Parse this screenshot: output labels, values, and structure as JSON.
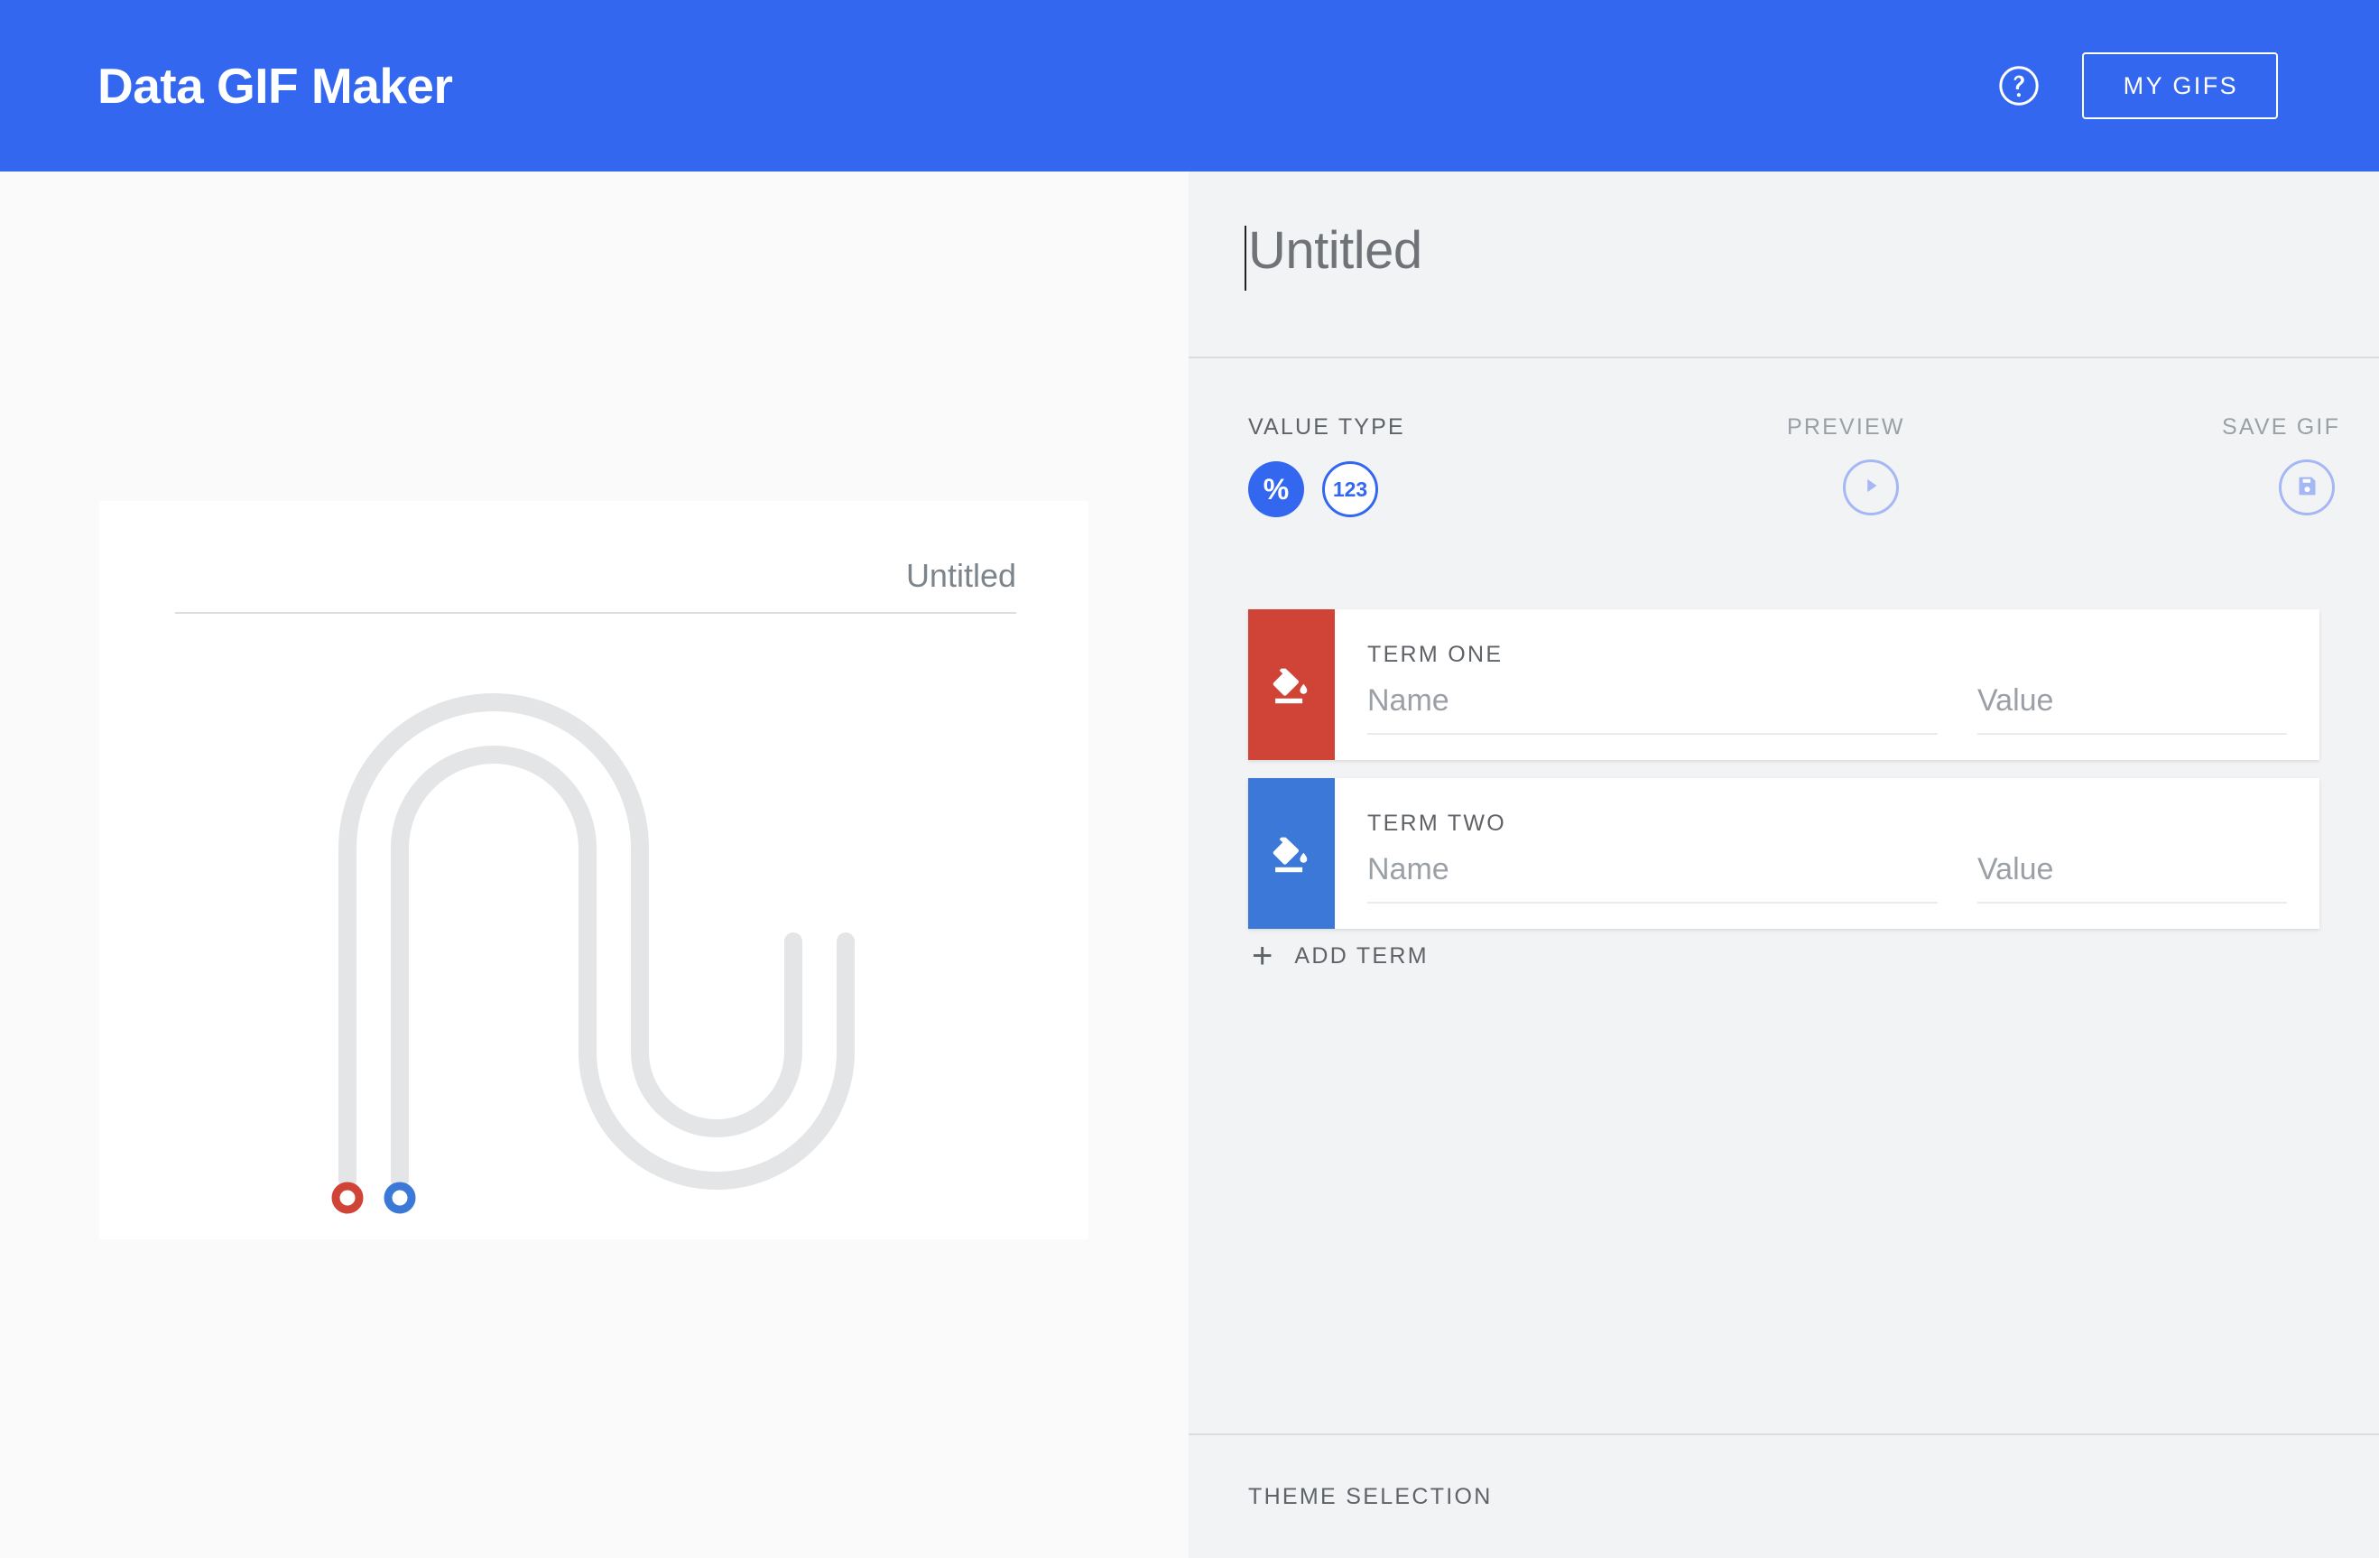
{
  "header": {
    "title": "Data GIF Maker",
    "help_icon": "help-circle-icon",
    "my_gifs_label": "MY GIFS",
    "background_color": "#3367f0"
  },
  "workspace": {
    "canvas": {
      "title": "Untitled",
      "background_color": "#ffffff",
      "track_color": "#e3e5e7",
      "markers": [
        {
          "term": "TERM ONE",
          "color": "#d04437"
        },
        {
          "term": "TERM TWO",
          "color": "#3b78d8"
        }
      ]
    }
  },
  "editor": {
    "project_title": {
      "value": "Untitled",
      "placeholder": "Untitled"
    },
    "toolbar": {
      "value_type_label": "VALUE TYPE",
      "value_type_options": [
        {
          "label": "%",
          "name": "percent",
          "selected": true
        },
        {
          "label": "123",
          "name": "number",
          "selected": false
        }
      ],
      "preview_label": "PREVIEW",
      "preview_icon": "play-icon",
      "save_gif_label": "SAVE GIF",
      "save_gif_icon": "save-floppy-icon",
      "disabled_color": "#a5b8f5",
      "accent_color": "#3367f0"
    },
    "terms": [
      {
        "heading": "TERM ONE",
        "color": "#d04437",
        "swatch_icon": "paint-bucket-icon",
        "name_value": "",
        "name_placeholder": "Name",
        "value_value": "",
        "value_placeholder": "Value"
      },
      {
        "heading": "TERM TWO",
        "color": "#3b78d8",
        "swatch_icon": "paint-bucket-icon",
        "name_value": "",
        "name_placeholder": "Name",
        "value_value": "",
        "value_placeholder": "Value"
      }
    ],
    "add_term": {
      "plus": "+",
      "label": "ADD TERM"
    },
    "theme_selection": {
      "label": "THEME SELECTION"
    }
  }
}
